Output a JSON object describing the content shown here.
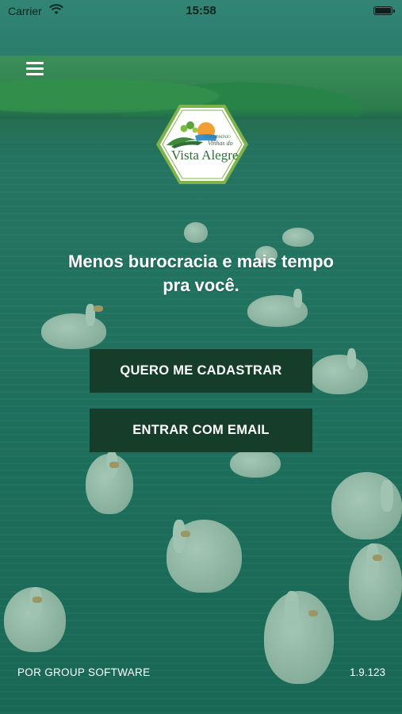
{
  "status_bar": {
    "carrier": "Carrier",
    "time": "15:58"
  },
  "logo": {
    "small_text": "CONDOMÍNIO",
    "script_text": "Vinhas do",
    "main_text": "Vista Alegre"
  },
  "tagline": {
    "line1": "Menos burocracia e mais tempo",
    "line2": "pra você."
  },
  "buttons": {
    "register_label": "QUERO ME CADASTRAR",
    "email_label": "ENTRAR COM EMAIL"
  },
  "footer": {
    "credit": "POR GROUP SOFTWARE",
    "version": "1.9.123"
  },
  "colors": {
    "button_bg": "#153d2a",
    "text": "#ffffff",
    "overlay": "#1f6a5a"
  },
  "icons": [
    "wifi-icon",
    "battery-icon",
    "hamburger-menu-icon"
  ]
}
